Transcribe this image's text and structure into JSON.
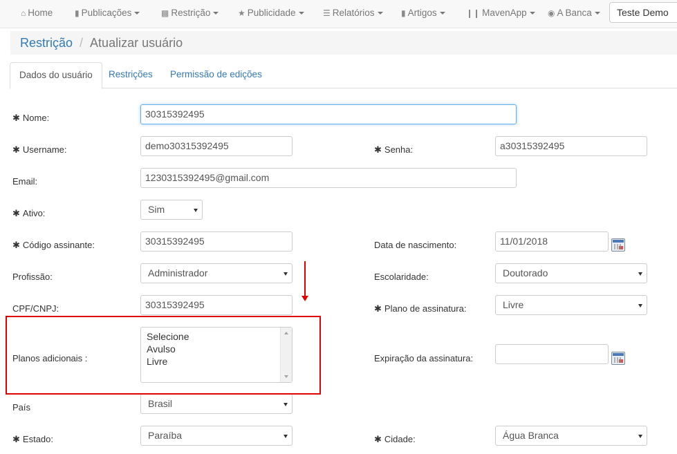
{
  "navbar": {
    "items": [
      {
        "icon": "home-icon",
        "label": "Home",
        "dropdown": false
      },
      {
        "icon": "file-icon",
        "label": "Publicações",
        "dropdown": true
      },
      {
        "icon": "lock-icon",
        "label": "Restrição",
        "dropdown": true
      },
      {
        "icon": "star-icon",
        "label": "Publicidade",
        "dropdown": true
      },
      {
        "icon": "list-icon",
        "label": "Relatórios",
        "dropdown": true
      },
      {
        "icon": "bookmark-icon",
        "label": "Artigos",
        "dropdown": true
      },
      {
        "icon": "barcode-icon",
        "label": "MavenApp",
        "dropdown": true
      },
      {
        "icon": "globe-icon",
        "label": "A Banca",
        "dropdown": true
      }
    ],
    "user_button": "Teste Demo"
  },
  "breadcrumb": {
    "parent": "Restrição",
    "separator": "/",
    "current": "Atualizar usuário"
  },
  "tabs": [
    {
      "label": "Dados do usuário",
      "active": true
    },
    {
      "label": "Restrições",
      "active": false
    },
    {
      "label": "Permissão de edições",
      "active": false
    }
  ],
  "form": {
    "nome": {
      "label": "Nome:",
      "value": "30315392495",
      "required": true
    },
    "username": {
      "label": "Username:",
      "value": "demo30315392495",
      "required": true
    },
    "senha": {
      "label": "Senha:",
      "value": "a30315392495",
      "required": true
    },
    "email": {
      "label": "Email:",
      "value": "1230315392495@gmail.com"
    },
    "ativo": {
      "label": "Ativo:",
      "value": "Sim",
      "required": true
    },
    "codigo_assinante": {
      "label": "Código assinante:",
      "value": "30315392495",
      "required": true
    },
    "data_nascimento": {
      "label": "Data de nascimento:",
      "value": "11/01/2018"
    },
    "profissao": {
      "label": "Profissão:",
      "value": "Administrador"
    },
    "escolaridade": {
      "label": "Escolaridade:",
      "value": "Doutorado"
    },
    "cpf_cnpj": {
      "label": "CPF/CNPJ:",
      "value": "30315392495"
    },
    "plano_assinatura": {
      "label": "Plano de assinatura:",
      "value": "Livre",
      "required": true
    },
    "planos_adicionais": {
      "label": "Planos adicionais :",
      "options": [
        "Selecione",
        "Avulso",
        "Livre"
      ]
    },
    "expiracao_assinatura": {
      "label": "Expiração da assinatura:",
      "value": ""
    },
    "pais": {
      "label": "País",
      "value": "Brasil"
    },
    "estado": {
      "label": "Estado:",
      "value": "Paraíba",
      "required": true
    },
    "cidade": {
      "label": "Cidade:",
      "value": "Água Branca",
      "required": true
    }
  },
  "required_marker": "✱",
  "colors": {
    "link": "#337ab7",
    "annotation": "#e00000"
  }
}
